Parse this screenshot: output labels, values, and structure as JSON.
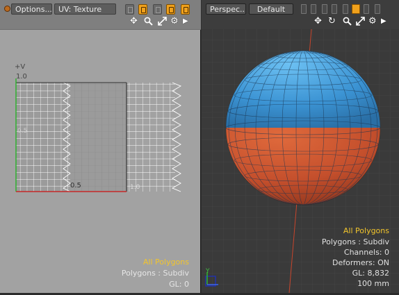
{
  "uv_panel": {
    "options_label": "Options....",
    "uv_dropdown": "UV: Texture",
    "axis_v_label": "+V",
    "tick_1_0": "1.0",
    "tick_0_5_v": "0.5",
    "tick_0_5_u": "0.5",
    "tick_1_0_u": "1.0",
    "info_selection": "All Polygons",
    "info_polygons": "Polygons : Subdiv",
    "info_gl": "GL: 0"
  },
  "view_panel": {
    "view_dropdown": "Perspec...",
    "shading_dropdown": "Default",
    "info_selection": "All Polygons",
    "info_polygons": "Polygons : Subdiv",
    "info_channels": "Channels: 0",
    "info_deformers": "Deformers: ON",
    "info_gl": "GL: 8,832",
    "info_scale": "100 mm",
    "axis_y": "Y"
  },
  "colors": {
    "accent": "#f0a11c",
    "sphere_top": "#3c98d8",
    "sphere_bottom": "#c9522f",
    "highlight_text": "#f2c52c"
  },
  "icons": [
    "move-view-icon",
    "zoom-icon",
    "fit-icon",
    "gear-icon",
    "arrow-right-icon",
    "rotate-icon"
  ]
}
